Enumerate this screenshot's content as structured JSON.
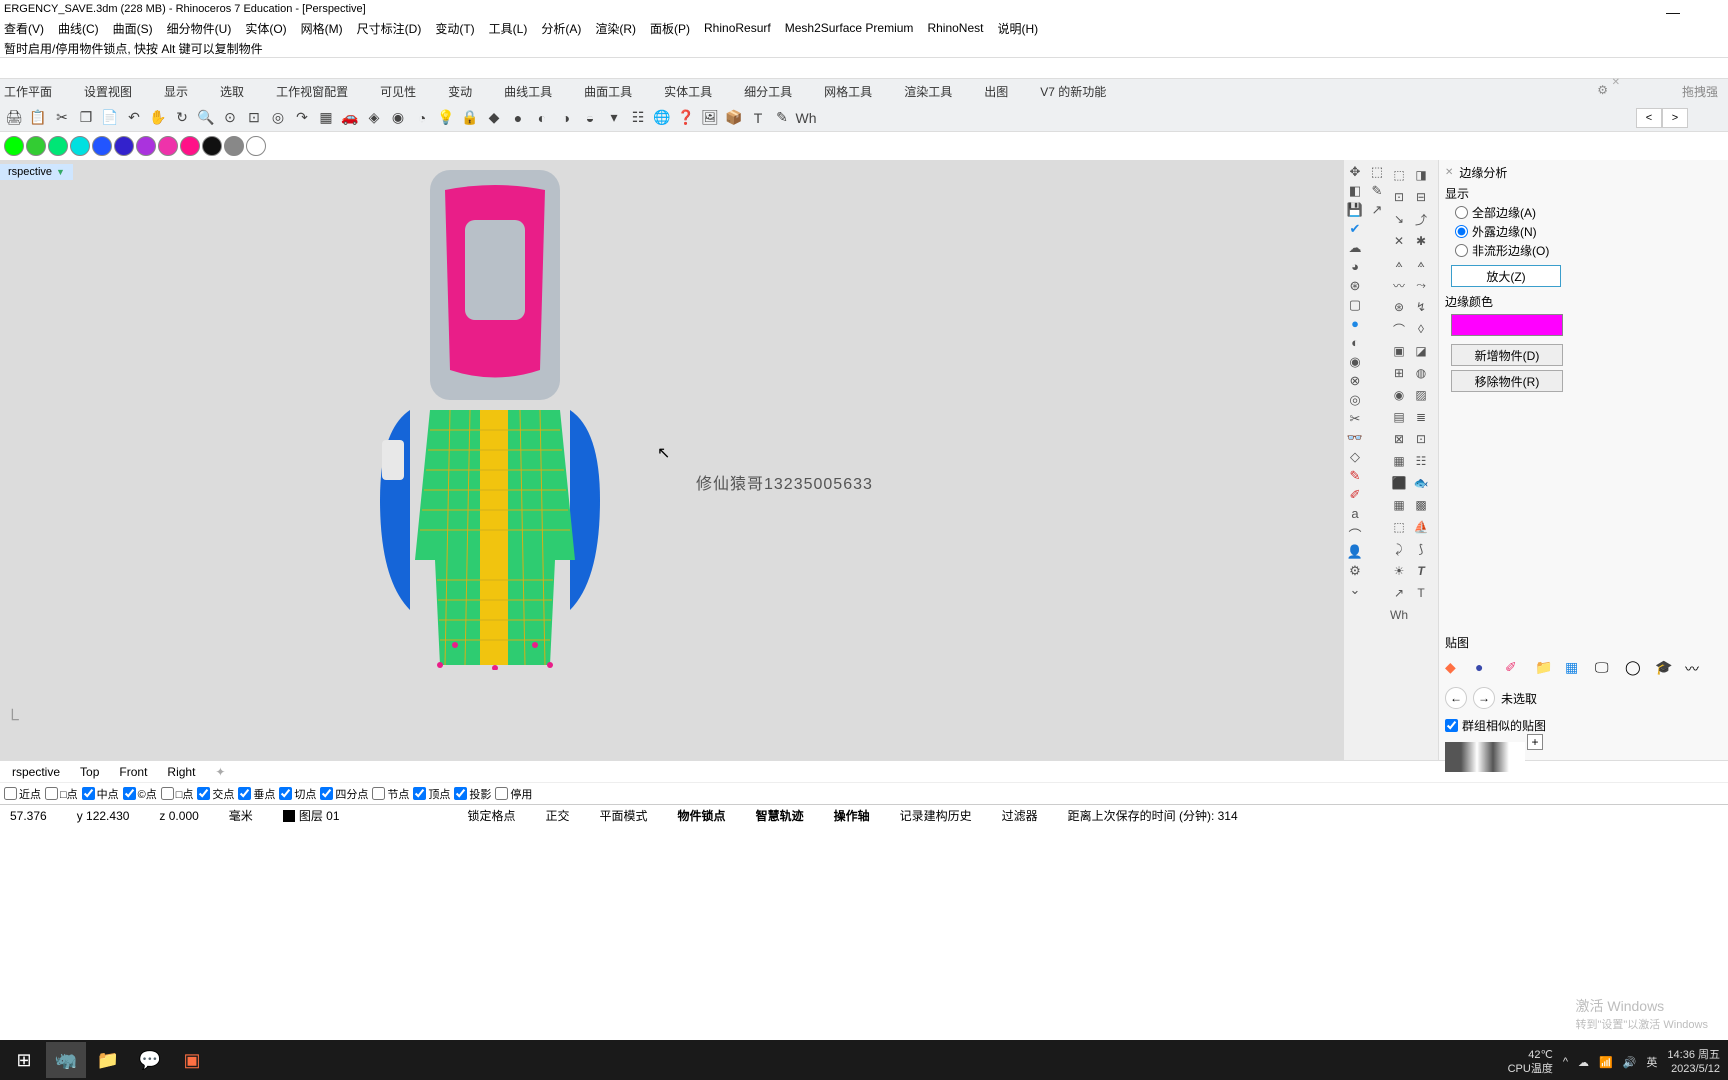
{
  "title": "ERGENCY_SAVE.3dm (228 MB) - Rhinoceros 7 Education - [Perspective]",
  "menu": [
    "查看(V)",
    "曲线(C)",
    "曲面(S)",
    "细分物件(U)",
    "实体(O)",
    "网格(M)",
    "尺寸标注(D)",
    "变动(T)",
    "工具(L)",
    "分析(A)",
    "渲染(R)",
    "面板(P)",
    "RhinoResurf",
    "Mesh2Surface Premium",
    "RhinoNest",
    "说明(H)"
  ],
  "cmd": "暂时启用/停用物件锁点, 快按 Alt 键可以复制物件",
  "tabs": [
    "工作平面",
    "设置视图",
    "显示",
    "选取",
    "工作视窗配置",
    "可见性",
    "变动",
    "曲线工具",
    "曲面工具",
    "实体工具",
    "细分工具",
    "网格工具",
    "渲染工具",
    "出图",
    "V7 的新功能"
  ],
  "drag": "拖拽强",
  "colors": [
    "#00ff00",
    "#33cc33",
    "#00e676",
    "#00e0e0",
    "#2255ff",
    "#3322cc",
    "#aa33dd",
    "#ee33aa",
    "#ff1188",
    "#111111",
    "#888888",
    "#ffffff"
  ],
  "vplabel": "rspective",
  "watermark": "修仙猿哥13235005633",
  "rpanel": {
    "title": "边缘分析",
    "sec1": "显示",
    "r1": "全部边缘(A)",
    "r2": "外露边缘(N)",
    "r3": "非流形边缘(O)",
    "zoom": "放大(Z)",
    "sec2": "边缘颜色",
    "add": "新增物件(D)",
    "rem": "移除物件(R)",
    "tex": "贴图",
    "unsel": "未选取",
    "grp": "群组相似的贴图"
  },
  "activate": {
    "l1": "激活 Windows",
    "l2": "转到\"设置\"以激活 Windows"
  },
  "vtabs": [
    "rspective",
    "Top",
    "Front",
    "Right"
  ],
  "osnap": [
    "近点",
    "□点",
    "中点",
    "©点",
    "□点",
    "交点",
    "垂点",
    "切点",
    "四分点",
    "节点",
    "顶点",
    "投影",
    "停用"
  ],
  "status": {
    "x": "57.376",
    "y": "y 122.430",
    "z": "z 0.000",
    "unit": "毫米",
    "layer": "图层 01",
    "items": [
      "锁定格点",
      "正交",
      "平面模式",
      "物件锁点",
      "智慧轨迹",
      "操作轴",
      "记录建构历史",
      "过滤器",
      "距离上次保存的时间 (分钟): 314"
    ]
  },
  "tray": {
    "temp": "42℃",
    "cpu": "CPU温度",
    "ime": "英",
    "time": "14:36 周五",
    "date": "2023/5/12"
  }
}
